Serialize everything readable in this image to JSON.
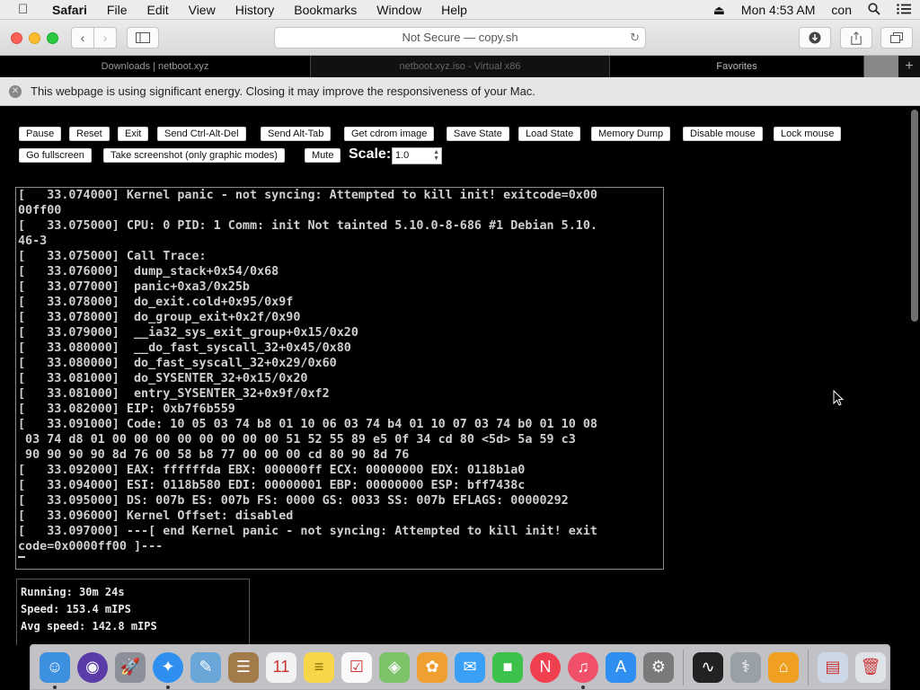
{
  "menubar": {
    "app": "Safari",
    "items": [
      "File",
      "Edit",
      "View",
      "History",
      "Bookmarks",
      "Window",
      "Help"
    ],
    "clock": "Mon 4:53 AM",
    "user": "con"
  },
  "browser": {
    "url": "Not Secure — copy.sh",
    "tabs": [
      "Downloads | netboot.xyz",
      "netboot.xyz.iso - Virtual x86",
      "Favorites"
    ],
    "active_tab_index": 1,
    "energy_warning": "This webpage is using significant energy. Closing it may improve the responsiveness of your Mac."
  },
  "controls": {
    "row1": [
      "Pause",
      "Reset",
      "Exit",
      "Send Ctrl-Alt-Del",
      "Send Alt-Tab",
      "Get cdrom image",
      "Save State",
      "Load State",
      "Memory Dump",
      "Disable mouse",
      "Lock mouse"
    ],
    "row2": [
      "Go fullscreen",
      "Take screenshot (only graphic modes)",
      "Mute"
    ],
    "scale_label": "Scale:",
    "scale_value": "1.0"
  },
  "terminal": {
    "lines": [
      "[   33.074000] Kernel panic - not syncing: Attempted to kill init! exitcode=0x00",
      "00ff00",
      "[   33.075000] CPU: 0 PID: 1 Comm: init Not tainted 5.10.0-8-686 #1 Debian 5.10.",
      "46-3",
      "[   33.075000] Call Trace:",
      "[   33.076000]  dump_stack+0x54/0x68",
      "[   33.077000]  panic+0xa3/0x25b",
      "[   33.078000]  do_exit.cold+0x95/0x9f",
      "[   33.078000]  do_group_exit+0x2f/0x90",
      "[   33.079000]  __ia32_sys_exit_group+0x15/0x20",
      "[   33.080000]  __do_fast_syscall_32+0x45/0x80",
      "[   33.080000]  do_fast_syscall_32+0x29/0x60",
      "[   33.081000]  do_SYSENTER_32+0x15/0x20",
      "[   33.081000]  entry_SYSENTER_32+0x9f/0xf2",
      "[   33.082000] EIP: 0xb7f6b559",
      "[   33.091000] Code: 10 05 03 74 b8 01 10 06 03 74 b4 01 10 07 03 74 b0 01 10 08",
      " 03 74 d8 01 00 00 00 00 00 00 00 00 51 52 55 89 e5 0f 34 cd 80 <5d> 5a 59 c3",
      " 90 90 90 90 8d 76 00 58 b8 77 00 00 00 cd 80 90 8d 76",
      "[   33.092000] EAX: ffffffda EBX: 000000ff ECX: 00000000 EDX: 0118b1a0",
      "[   33.094000] ESI: 0118b580 EDI: 00000001 EBP: 00000000 ESP: bff7438c",
      "[   33.095000] DS: 007b ES: 007b FS: 0000 GS: 0033 SS: 007b EFLAGS: 00000292",
      "[   33.096000] Kernel Offset: disabled",
      "[   33.097000] ---[ end Kernel panic - not syncing: Attempted to kill init! exit",
      "code=0x0000ff00 ]---"
    ]
  },
  "stats": {
    "running": "Running: 30m 24s",
    "speed": "Speed: 153.4 mIPS",
    "avg_speed": "Avg speed: 142.8 mIPS"
  },
  "dock": {
    "apps": [
      {
        "icon": "finder-icon",
        "color": "#3d8fe0"
      },
      {
        "icon": "siri-icon",
        "color": "#5a3ba8"
      },
      {
        "icon": "launchpad-icon",
        "color": "#8a8f99"
      },
      {
        "icon": "safari-icon",
        "color": "#2f8ff0"
      },
      {
        "icon": "preview-icon",
        "color": "#6aa7d8"
      },
      {
        "icon": "contacts-icon",
        "color": "#a37a4a"
      },
      {
        "icon": "calendar-icon",
        "color": "#f2f2f2"
      },
      {
        "icon": "notes-icon",
        "color": "#f7d64a"
      },
      {
        "icon": "reminders-icon",
        "color": "#fafafa"
      },
      {
        "icon": "maps-icon",
        "color": "#7cc36a"
      },
      {
        "icon": "photos-icon",
        "color": "#f0a030"
      },
      {
        "icon": "messages-icon",
        "color": "#3aa0f5"
      },
      {
        "icon": "facetime-icon",
        "color": "#3cc24a"
      },
      {
        "icon": "news-icon",
        "color": "#f04050"
      },
      {
        "icon": "music-icon",
        "color": "#f0506a"
      },
      {
        "icon": "app-store-icon",
        "color": "#2f8ff0"
      },
      {
        "icon": "system-preferences-icon",
        "color": "#7a7a7a"
      },
      {
        "icon": "activity-monitor-icon",
        "color": "#222"
      },
      {
        "icon": "network-utility-icon",
        "color": "#9aa0a8"
      },
      {
        "icon": "home-icon",
        "color": "#f0a020"
      },
      {
        "icon": "downloads-folder-icon",
        "color": "#cdd8e6"
      },
      {
        "icon": "trash-icon",
        "color": "#dfe3e8"
      }
    ]
  }
}
